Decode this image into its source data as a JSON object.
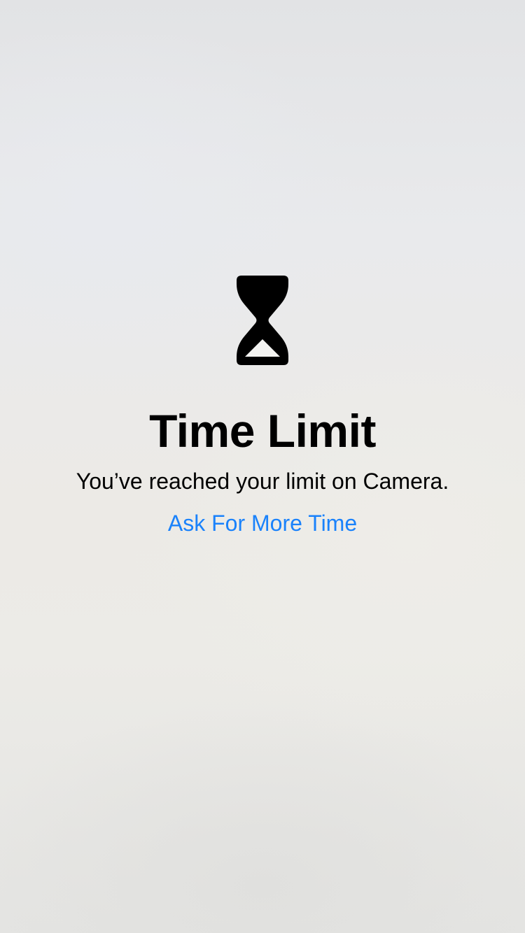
{
  "screen": {
    "icon": "hourglass-icon",
    "title": "Time Limit",
    "message": "You’ve reached your limit on Camera.",
    "action_label": "Ask For More Time"
  },
  "colors": {
    "text": "#000000",
    "link": "#1a82fb",
    "background": "#e9e9e7"
  }
}
